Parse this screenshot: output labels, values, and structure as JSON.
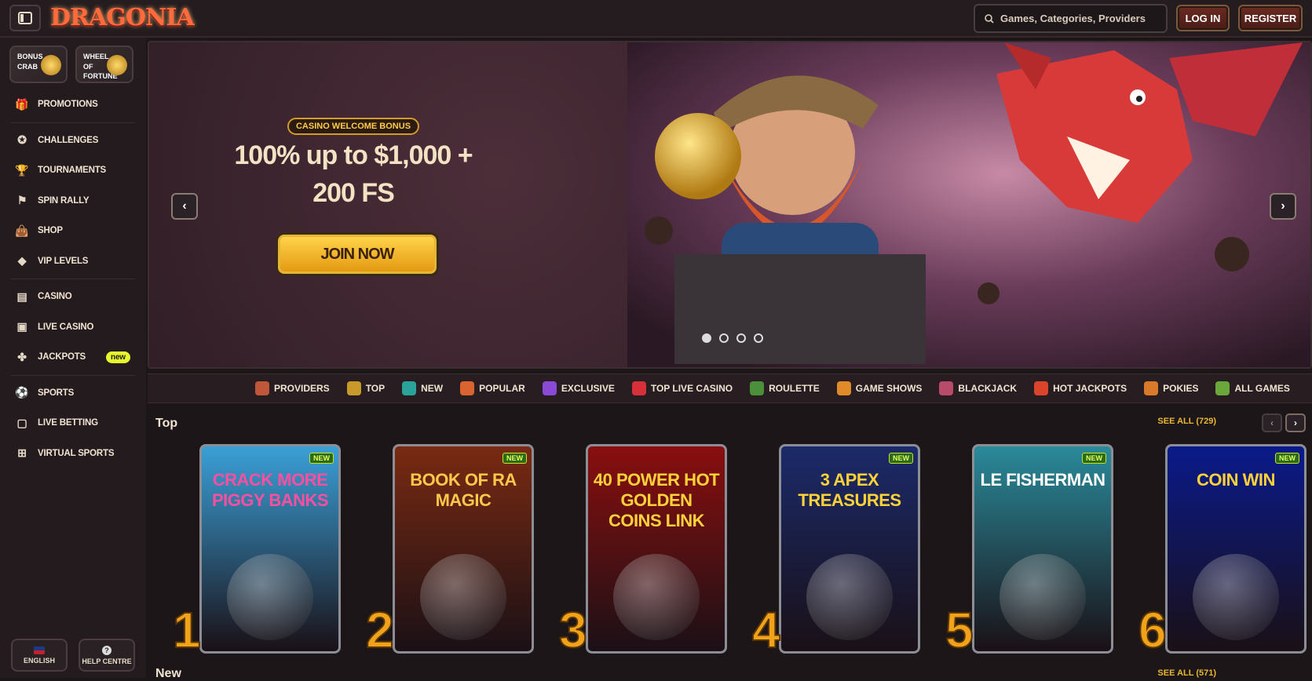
{
  "brand": {
    "logo_text": "DRAGONIA"
  },
  "header": {
    "search_placeholder": "Games, Categories, Providers",
    "login_label": "LOG IN",
    "register_label": "REGISTER"
  },
  "sidebar": {
    "mini_cards": [
      {
        "label": "BONUS CRAB"
      },
      {
        "label": "WHEEL OF FORTUNE"
      }
    ],
    "items": [
      {
        "label": "PROMOTIONS",
        "icon": "gift-icon"
      },
      {
        "label": "CHALLENGES",
        "icon": "medal-icon"
      },
      {
        "label": "TOURNAMENTS",
        "icon": "trophy-icon"
      },
      {
        "label": "SPIN RALLY",
        "icon": "rally-icon"
      },
      {
        "label": "SHOP",
        "icon": "shopping-bag-icon"
      },
      {
        "label": "VIP LEVELS",
        "icon": "diamond-icon"
      },
      {
        "label": "CASINO",
        "icon": "slot-icon"
      },
      {
        "label": "LIVE CASINO",
        "icon": "cards-icon"
      },
      {
        "label": "JACKPOTS",
        "icon": "clover-icon",
        "badge": "new"
      },
      {
        "label": "SPORTS",
        "icon": "ball-icon"
      },
      {
        "label": "LIVE BETTING",
        "icon": "live-icon"
      },
      {
        "label": "VIRTUAL SPORTS",
        "icon": "virtual-icon"
      }
    ],
    "language_label": "ENGLISH",
    "help_label": "HELP CENTRE"
  },
  "hero": {
    "pill": "CASINO WELCOME BONUS",
    "title_line1": "100% up to $1,000 +",
    "title_line2": "200 FS",
    "cta": "JOIN NOW",
    "slides": 4,
    "active_slide": 1
  },
  "categories": [
    {
      "label": "PROVIDERS",
      "color": "#c0573a"
    },
    {
      "label": "TOP",
      "color": "#c79a2a"
    },
    {
      "label": "NEW",
      "color": "#2aa39a"
    },
    {
      "label": "POPULAR",
      "color": "#d9642f"
    },
    {
      "label": "EXCLUSIVE",
      "color": "#8a4ad6"
    },
    {
      "label": "TOP LIVE CASINO",
      "color": "#d8303a"
    },
    {
      "label": "ROULETTE",
      "color": "#4a8f3a"
    },
    {
      "label": "GAME SHOWS",
      "color": "#e08a2a"
    },
    {
      "label": "BLACKJACK",
      "color": "#b84a6a"
    },
    {
      "label": "HOT JACKPOTS",
      "color": "#d9442a"
    },
    {
      "label": "POKIES",
      "color": "#d97a2a"
    },
    {
      "label": "ALL GAMES",
      "color": "#6aa83a"
    }
  ],
  "top_section": {
    "title": "Top",
    "see_all": "SEE ALL (729)",
    "games": [
      {
        "rank": "1",
        "name": "CRACK MORE PIGGY BANKS",
        "new": "NEW",
        "bg": "#3aa0d8",
        "fg": "#ff4fa0"
      },
      {
        "rank": "2",
        "name": "BOOK OF RA MAGIC",
        "new": "NEW",
        "bg": "#7a2a12",
        "fg": "#ffc84a"
      },
      {
        "rank": "3",
        "name": "40 POWER HOT GOLDEN COINS LINK",
        "new": "",
        "bg": "#8a0f0f",
        "fg": "#ffd23a"
      },
      {
        "rank": "4",
        "name": "3 APEX TREASURES",
        "new": "NEW",
        "bg": "#1b2a6a",
        "fg": "#ffd23a"
      },
      {
        "rank": "5",
        "name": "LE FISHERMAN",
        "new": "NEW",
        "bg": "#2a8a9a",
        "fg": "#ffffff"
      },
      {
        "rank": "6",
        "name": "COIN WIN",
        "new": "NEW",
        "bg": "#0a1a8a",
        "fg": "#ffd23a"
      }
    ]
  },
  "new_section": {
    "title": "New",
    "see_all": "SEE ALL (571)"
  }
}
